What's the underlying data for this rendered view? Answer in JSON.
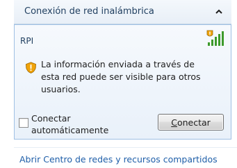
{
  "header": {
    "title": "Conexión de red inalámbrica"
  },
  "network": {
    "name": "RPI",
    "warning": "La información enviada a través de esta red puede ser visible para otros usuarios.",
    "auto_connect_label": "Conectar automáticamente",
    "auto_connect_checked": false,
    "connect_button_first": "C",
    "connect_button_rest": "onectar"
  },
  "footer": {
    "link": "Abrir Centro de redes y recursos compartidos"
  },
  "icons": {
    "collapse": "chevron-up-icon",
    "signal": "wifi-signal-icon",
    "warning": "shield-warning-icon"
  },
  "colors": {
    "accent": "#1e5ea8",
    "warning": "#f0a30a",
    "signal": "#3d9a2b"
  }
}
